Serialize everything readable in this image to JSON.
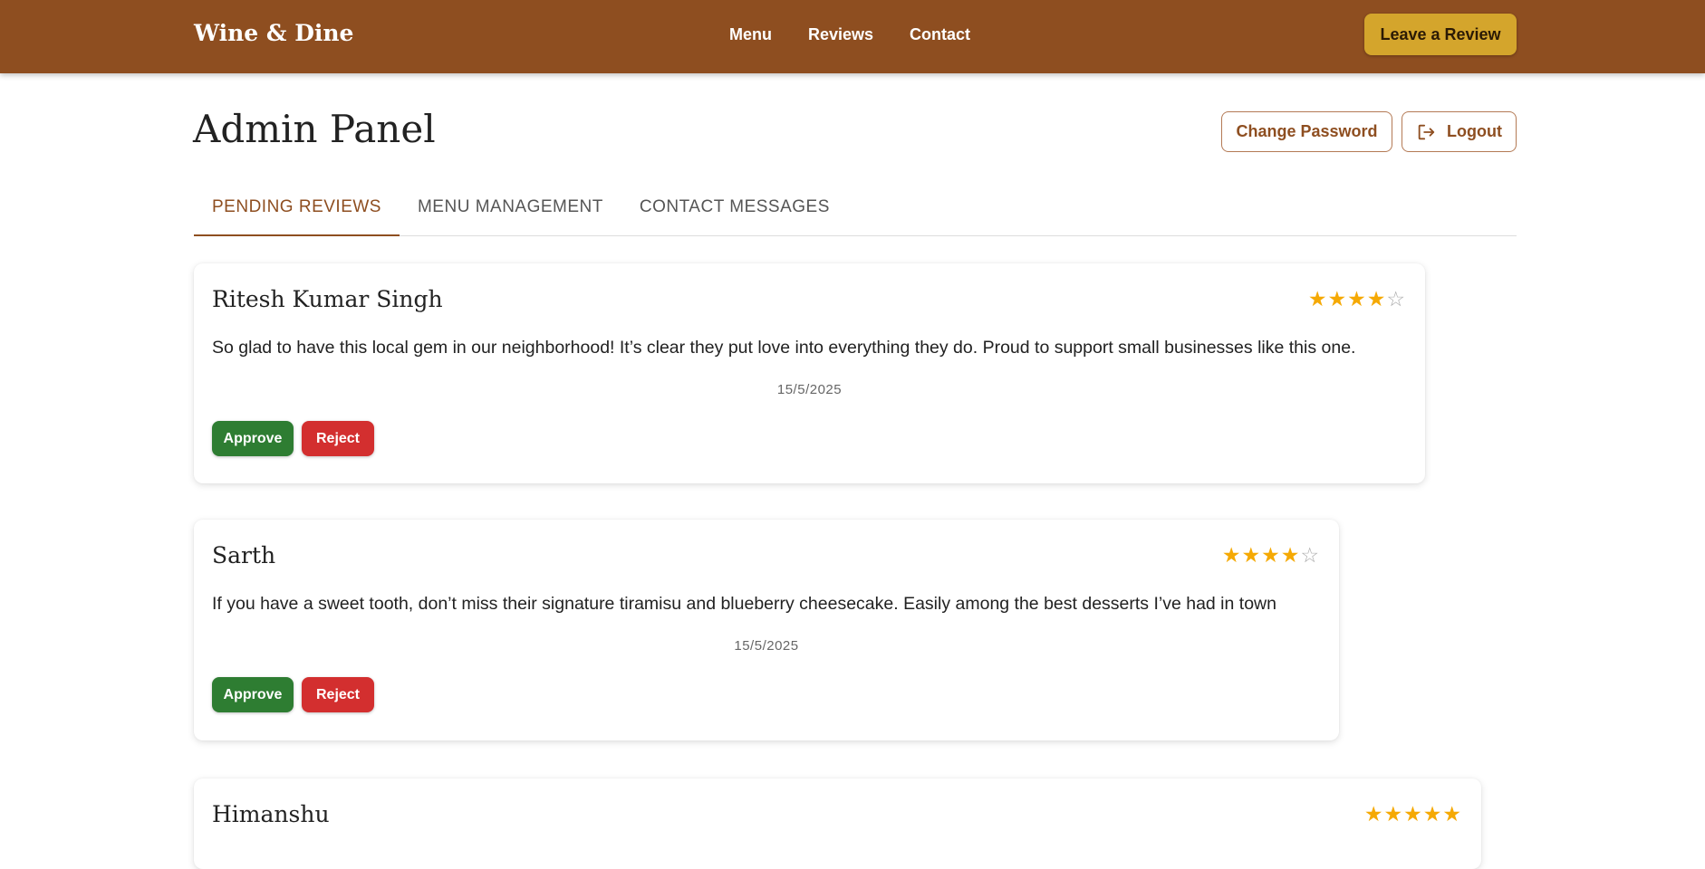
{
  "header": {
    "brand": "Wine & Dine",
    "nav": [
      "Menu",
      "Reviews",
      "Contact"
    ],
    "cta": "Leave a Review"
  },
  "page": {
    "title": "Admin Panel",
    "change_password": "Change Password",
    "logout": "Logout"
  },
  "tabs": [
    "PENDING REVIEWS",
    "MENU MANAGEMENT",
    "CONTACT MESSAGES"
  ],
  "active_tab": 0,
  "reviews": [
    {
      "name": "Ritesh Kumar Singh",
      "rating": 4,
      "max_rating": 5,
      "text": "So glad to have this local gem in our neighborhood! It’s clear they put love into everything they do. Proud to support small businesses like this one.",
      "date": "15/5/2025",
      "approve": "Approve",
      "reject": "Reject"
    },
    {
      "name": "Sarth",
      "rating": 4,
      "max_rating": 5,
      "text": "If you have a sweet tooth, don’t miss their signature tiramisu and blueberry cheesecake. Easily among the best desserts I’ve had in town",
      "date": "15/5/2025",
      "approve": "Approve",
      "reject": "Reject"
    },
    {
      "name": "Himanshu",
      "rating": 5,
      "max_rating": 5
    }
  ],
  "colors": {
    "header_bg": "#8e4e20",
    "accent": "#8e4e20",
    "cta_bg": "#d4a52c",
    "star": "#f5a904",
    "approve": "#2e7d32",
    "reject": "#d32f2f"
  }
}
